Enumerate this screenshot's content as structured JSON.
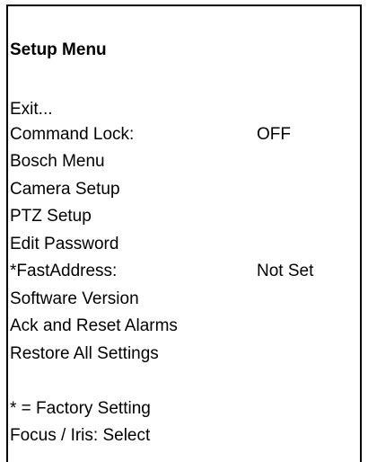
{
  "menu": {
    "title": "Setup Menu",
    "items": [
      {
        "label": "Exit...",
        "value": ""
      },
      {
        "label": "Command Lock:",
        "value": "OFF"
      },
      {
        "label": "Bosch Menu",
        "value": ""
      },
      {
        "label": "Camera Setup",
        "value": ""
      },
      {
        "label": "PTZ Setup",
        "value": ""
      },
      {
        "label": "Edit Password",
        "value": ""
      },
      {
        "label": "*FastAddress:",
        "value": "Not Set"
      },
      {
        "label": "Software Version",
        "value": ""
      },
      {
        "label": "Ack and Reset Alarms",
        "value": ""
      },
      {
        "label": "Restore All Settings",
        "value": ""
      }
    ],
    "footer": {
      "legend": "* = Factory Setting",
      "hint": "Focus / Iris: Select"
    }
  }
}
